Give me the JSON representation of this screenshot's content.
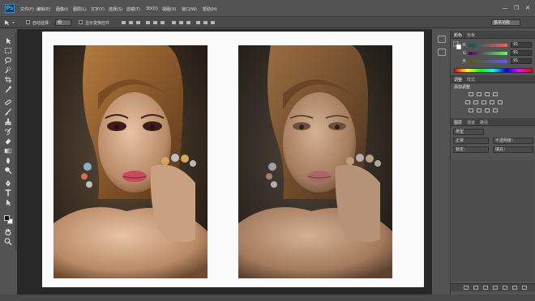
{
  "app": {
    "logo": "Ps"
  },
  "menu": [
    "文件(F)",
    "编辑(E)",
    "图像(I)",
    "图层(L)",
    "文字(Y)",
    "选择(S)",
    "滤镜(T)",
    "3D(D)",
    "视图(V)",
    "窗口(W)",
    "帮助(H)"
  ],
  "window_controls": {
    "minimize": "—",
    "restore": "❐",
    "close": "✕"
  },
  "options_bar": {
    "auto_select_label": "自动选择：",
    "auto_select_value": "组",
    "show_transform_label": "显示变换控件"
  },
  "workspace": {
    "value": "基本功能"
  },
  "panels": {
    "color": {
      "tabs": [
        "颜色",
        "色板"
      ],
      "sliders": [
        {
          "label": "R",
          "value": "91"
        },
        {
          "label": "G",
          "value": "91"
        },
        {
          "label": "B",
          "value": "91"
        }
      ]
    },
    "adjustments": {
      "tabs": [
        "调整",
        "样式"
      ],
      "title": "添加调整"
    },
    "layers": {
      "tabs": [
        "图层",
        "通道",
        "路径"
      ],
      "kind_label": "类型",
      "blend_mode": "正常",
      "opacity_label": "不透明度：",
      "lock_label": "锁定：",
      "fill_label": "填充："
    }
  },
  "colors": {
    "ui_bg": "#535353",
    "canvas_bg": "#282828",
    "document_bg": "#fbfbfb",
    "accent": "#2d8fd4"
  },
  "icons": [
    "move-tool-icon",
    "marquee-tool-icon",
    "lasso-tool-icon",
    "quick-select-tool-icon",
    "crop-tool-icon",
    "eyedropper-tool-icon",
    "healing-brush-tool-icon",
    "brush-tool-icon",
    "clone-stamp-tool-icon",
    "history-brush-tool-icon",
    "eraser-tool-icon",
    "gradient-tool-icon",
    "blur-tool-icon",
    "dodge-tool-icon",
    "pen-tool-icon",
    "type-tool-icon",
    "path-select-tool-icon",
    "shape-tool-icon",
    "hand-tool-icon",
    "zoom-tool-icon"
  ]
}
